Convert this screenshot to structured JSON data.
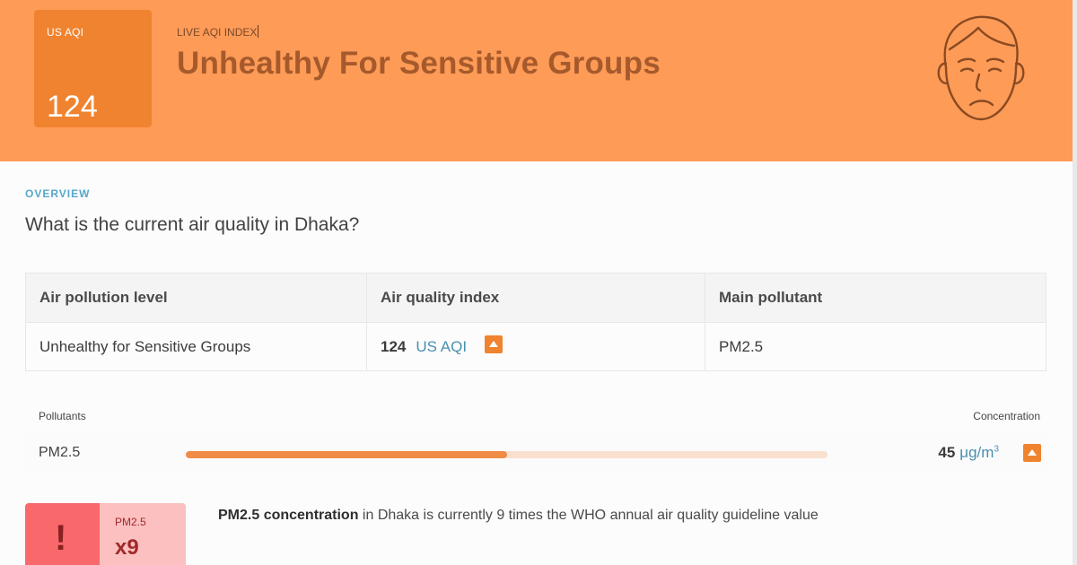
{
  "header": {
    "aqi_label": "US AQI",
    "aqi_value": "124",
    "live_label": "LIVE AQI INDEX",
    "status": "Unhealthy For Sensitive Groups",
    "face_icon": "sad-face-icon",
    "colors": {
      "banner": "#fe9b57",
      "aqi_box": "#f0832f",
      "status_text": "#a65a2c"
    }
  },
  "overview": {
    "section_label": "OVERVIEW",
    "question": "What is the current air quality in Dhaka?"
  },
  "table": {
    "headers": [
      "Air pollution level",
      "Air quality index",
      "Main pollutant"
    ],
    "level": "Unhealthy for Sensitive Groups",
    "aqi_value": "124",
    "aqi_unit": "US AQI",
    "trend_icon": "up-arrow-icon",
    "pollutant": "PM2.5"
  },
  "pollutants": {
    "header_left": "Pollutants",
    "header_right": "Concentration",
    "rows": [
      {
        "name": "PM2.5",
        "value": "45",
        "unit": "μg/m",
        "unit_sup": "3",
        "level_fraction": 0.5,
        "trend_icon": "up-arrow-icon"
      }
    ]
  },
  "who": {
    "icon": "exclamation-icon",
    "pollutant": "PM2.5",
    "multiplier": "x9",
    "bold_text": "PM2.5 concentration",
    "text": " in Dhaka is currently 9 times the WHO annual air quality guideline value",
    "colors": {
      "alert": "#f9686b",
      "alert_light": "#fbc0bf"
    }
  }
}
